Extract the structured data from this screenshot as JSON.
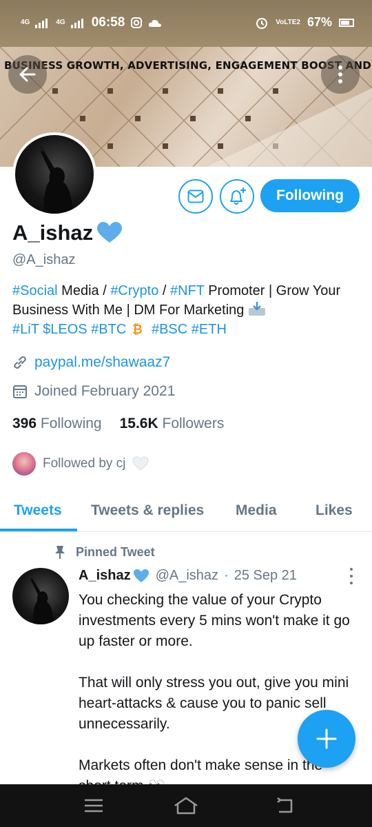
{
  "status_bar": {
    "network_left": "4G",
    "network_right": "4G",
    "time": "06:58",
    "volte": "VoLTE2",
    "battery": "67%"
  },
  "banner": {
    "text": "BUSINESS GROWTH, ADVERTISING, ENGAGEMENT BOOST AND MORE!"
  },
  "profile": {
    "name": "A_ishaz",
    "handle": "@A_ishaz",
    "bio": {
      "line1": [
        {
          "text": "#Social",
          "tag": true
        },
        {
          "text": " Media / ",
          "tag": false
        },
        {
          "text": "#Crypto",
          "tag": true
        },
        {
          "text": " / ",
          "tag": false
        },
        {
          "text": "#NFT",
          "tag": true
        },
        {
          "text": " Promoter | Grow Your Business With Me | DM For Marketing ",
          "tag": false
        }
      ],
      "line3": [
        {
          "text": "#LiT",
          "tag": true
        },
        {
          "text": " ",
          "tag": false
        },
        {
          "text": "$LEOS",
          "tag": true
        },
        {
          "text": " ",
          "tag": false
        },
        {
          "text": "#BTC",
          "tag": true
        }
      ],
      "line3b": [
        {
          "text": "#BSC",
          "tag": true
        },
        {
          "text": " ",
          "tag": false
        },
        {
          "text": "#ETH",
          "tag": true
        }
      ]
    },
    "link": "paypal.me/shawaaz7",
    "joined": "Joined February 2021",
    "following_count": "396",
    "following_label": "Following",
    "followers_count": "15.6K",
    "followers_label": "Followers",
    "followed_by": "Followed by cj"
  },
  "actions": {
    "follow_label": "Following"
  },
  "tabs": [
    {
      "label": "Tweets",
      "active": true
    },
    {
      "label": "Tweets & replies",
      "active": false
    },
    {
      "label": "Media",
      "active": false
    },
    {
      "label": "Likes",
      "active": false
    }
  ],
  "tweet": {
    "pinned_label": "Pinned Tweet",
    "name": "A_ishaz",
    "handle": "@A_ishaz",
    "date": "25 Sep 21",
    "paragraphs": [
      "You checking the value of your Crypto investments every 5 mins won't make it go up faster or more.",
      "That will only stress you out, give you mini heart-attacks & cause you to panic sell unnecessarily.",
      "Markets often don't make sense in the short term 👀"
    ]
  },
  "colors": {
    "accent": "#1da1f2",
    "link": "#1b95e0",
    "muted": "#657786"
  }
}
